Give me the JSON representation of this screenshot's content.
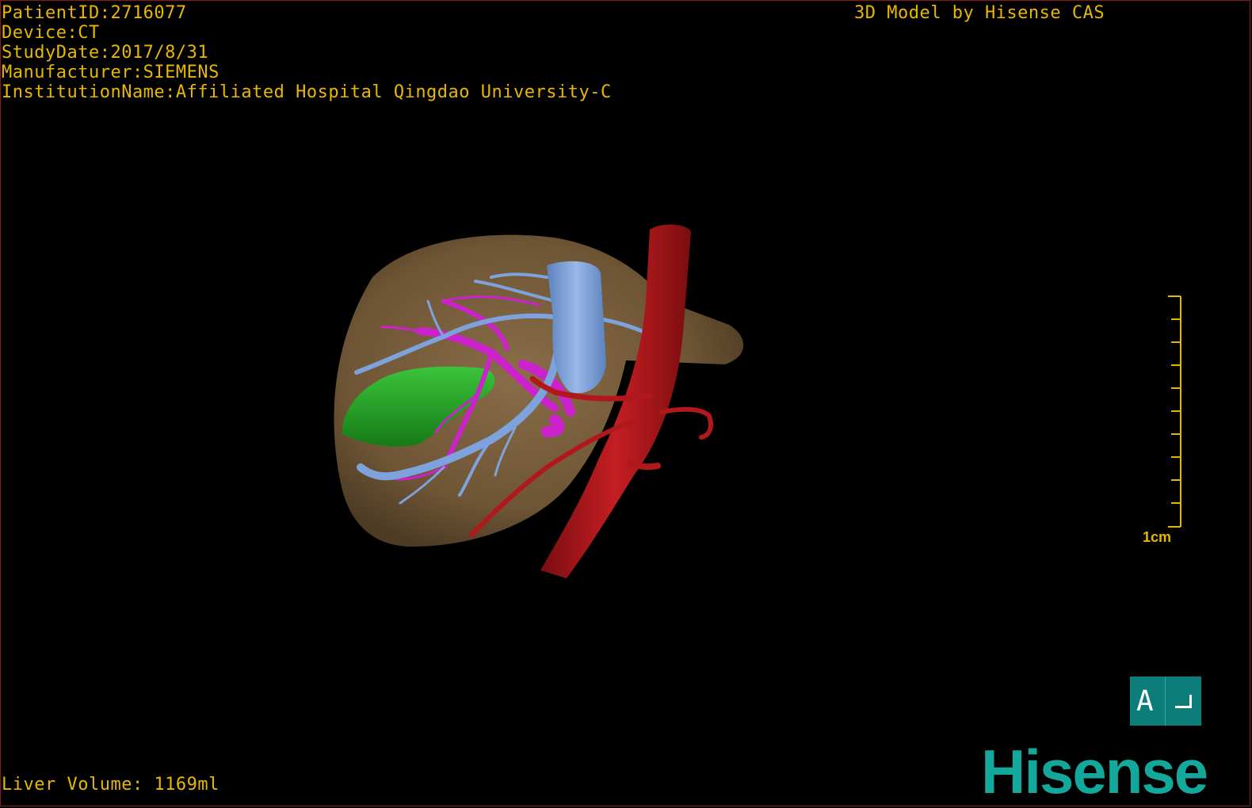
{
  "overlay": {
    "patient_id": "PatientID:2716077",
    "device": "Device:CT",
    "study_date": "StudyDate:2017/8/31",
    "manufacturer": "Manufacturer:SIEMENS",
    "institution": "InstitutionName:Affiliated Hospital Qingdao University-C",
    "credit": "3D Model by Hisense CAS",
    "liver_volume": "Liver Volume: 1169ml"
  },
  "scale_bar": {
    "label": "1cm"
  },
  "orientation": {
    "label": "A"
  },
  "brand": {
    "logo": "Hisense"
  },
  "colors": {
    "overlay_text": "#e8b800",
    "liver": "#7a5f3f",
    "portal_vein": "#7ea3dc",
    "hepatic_vein": "#cc22cc",
    "artery_aorta": "#b0181c",
    "lesion": "#22a322",
    "orientation_bg": "#0c7d78",
    "logo": "#14a89c"
  }
}
